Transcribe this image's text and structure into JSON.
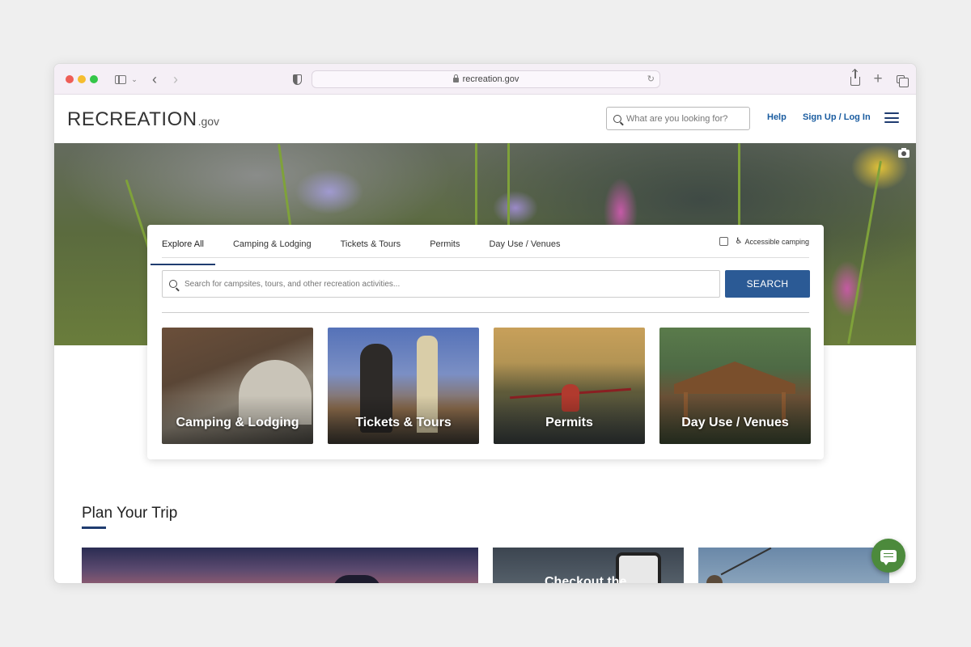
{
  "browser": {
    "url": "recreation.gov"
  },
  "site": {
    "logo_text": "RECREATION",
    "logo_suffix": ".gov",
    "header_search_placeholder": "What are you looking for?",
    "help_label": "Help",
    "signup_label": "Sign Up / Log In"
  },
  "search_panel": {
    "tabs": [
      {
        "label": "Explore All",
        "active": true
      },
      {
        "label": "Camping & Lodging",
        "active": false
      },
      {
        "label": "Tickets & Tours",
        "active": false
      },
      {
        "label": "Permits",
        "active": false
      },
      {
        "label": "Day Use / Venues",
        "active": false
      }
    ],
    "accessible_label": "Accessible camping",
    "accessible_checked": false,
    "search_placeholder": "Search for campsites, tours, and other recreation activities...",
    "search_button": "SEARCH",
    "cards": [
      {
        "label": "Camping & Lodging"
      },
      {
        "label": "Tickets & Tours"
      },
      {
        "label": "Permits"
      },
      {
        "label": "Day Use / Venues"
      }
    ]
  },
  "plan": {
    "title": "Plan Your Trip",
    "tile_2_text": "Checkout the"
  },
  "colors": {
    "primary": "#1f3c70",
    "search_button": "#2b5a95",
    "link": "#1a5ca0",
    "chat": "#4c8a3c"
  },
  "icons": [
    "sidebar-icon",
    "back-icon",
    "forward-icon",
    "shield-icon",
    "lock-icon",
    "reload-icon",
    "share-icon",
    "new-tab-icon",
    "tabs-overview-icon",
    "search-icon",
    "menu-icon",
    "camera-icon",
    "wheelchair-icon",
    "chat-icon"
  ]
}
